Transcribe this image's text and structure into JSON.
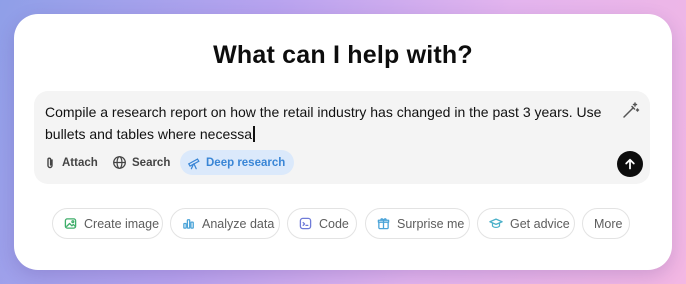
{
  "heading": "What can I help with?",
  "composer": {
    "prompt_text": "Compile a research report on how the retail industry has changed in the past 3 years. Use bullets and tables where necessa",
    "tools": {
      "attach": "Attach",
      "search": "Search",
      "deep_research": "Deep research"
    }
  },
  "suggestions": {
    "create_image": "Create image",
    "analyze_data": "Analyze data",
    "code": "Code",
    "surprise_me": "Surprise me",
    "get_advice": "Get advice",
    "more": "More"
  },
  "colors": {
    "deep_research_accent": "#3a86d6",
    "deep_research_bg": "#dbe9fb",
    "create_image_icon": "#3fae6a",
    "analyze_data_icon": "#4aa3d8",
    "code_icon": "#6f7bd8",
    "surprise_me_icon": "#4aa3d8",
    "get_advice_icon": "#4ab0c8"
  },
  "icons": [
    "paperclip-icon",
    "globe-icon",
    "telescope-icon",
    "magic-wand-icon",
    "arrow-up-icon",
    "image-icon",
    "bar-chart-icon",
    "code-icon",
    "gift-icon",
    "graduation-cap-icon"
  ]
}
